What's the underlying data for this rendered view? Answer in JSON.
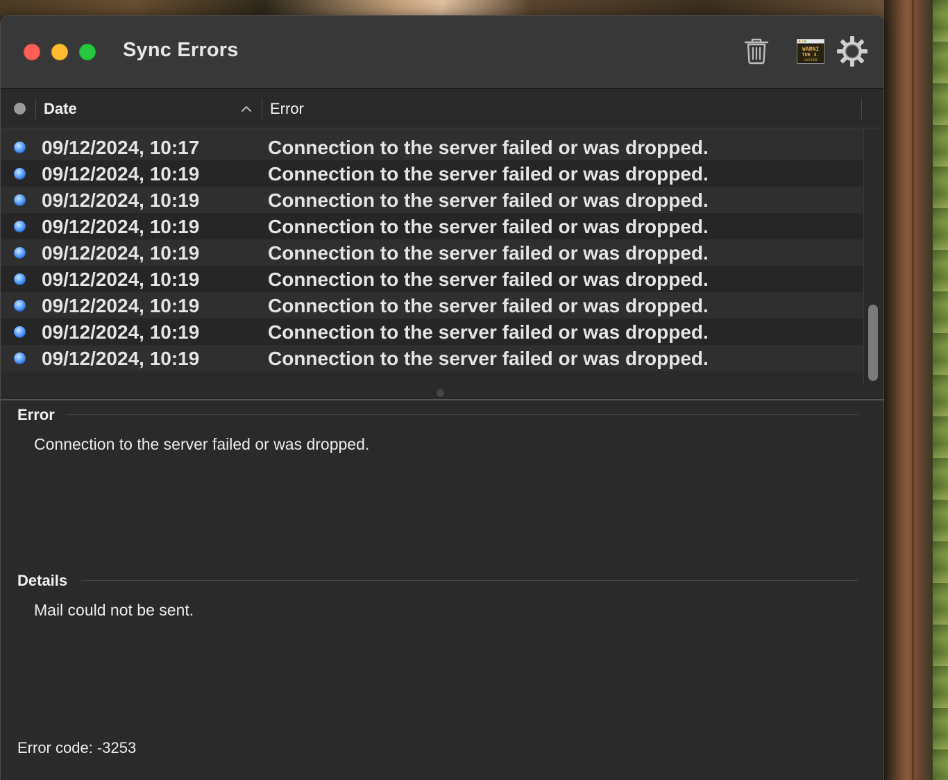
{
  "window": {
    "title": "Sync Errors"
  },
  "toolbar": {
    "trash_icon": "trash-icon",
    "console_icon": "console-icon",
    "console_icon_text": "WARNING TUE 3 SYSTEM",
    "settings_icon": "gear-icon"
  },
  "table": {
    "columns": {
      "date": "Date",
      "error": "Error"
    },
    "sort": "ascending",
    "rows": [
      {
        "date": "09/12/2024, 10:17",
        "error": "Connection to the server failed or was dropped."
      },
      {
        "date": "09/12/2024, 10:19",
        "error": "Connection to the server failed or was dropped."
      },
      {
        "date": "09/12/2024, 10:19",
        "error": "Connection to the server failed or was dropped."
      },
      {
        "date": "09/12/2024, 10:19",
        "error": "Connection to the server failed or was dropped."
      },
      {
        "date": "09/12/2024, 10:19",
        "error": "Connection to the server failed or was dropped."
      },
      {
        "date": "09/12/2024, 10:19",
        "error": "Connection to the server failed or was dropped."
      },
      {
        "date": "09/12/2024, 10:19",
        "error": "Connection to the server failed or was dropped."
      },
      {
        "date": "09/12/2024, 10:19",
        "error": "Connection to the server failed or was dropped."
      },
      {
        "date": "09/12/2024, 10:19",
        "error": "Connection to the server failed or was dropped."
      }
    ]
  },
  "detail": {
    "error_heading": "Error",
    "error_text": "Connection to the server failed or was dropped.",
    "details_heading": "Details",
    "details_text": "Mail could not be sent.",
    "error_code": "Error code: -3253"
  },
  "colors": {
    "window_bg": "#2a2a2a",
    "titlebar_bg": "#383838",
    "close": "#fe5f57",
    "minimize": "#febc2e",
    "maximize": "#28c840",
    "row_dot": "#2a6fe0"
  }
}
